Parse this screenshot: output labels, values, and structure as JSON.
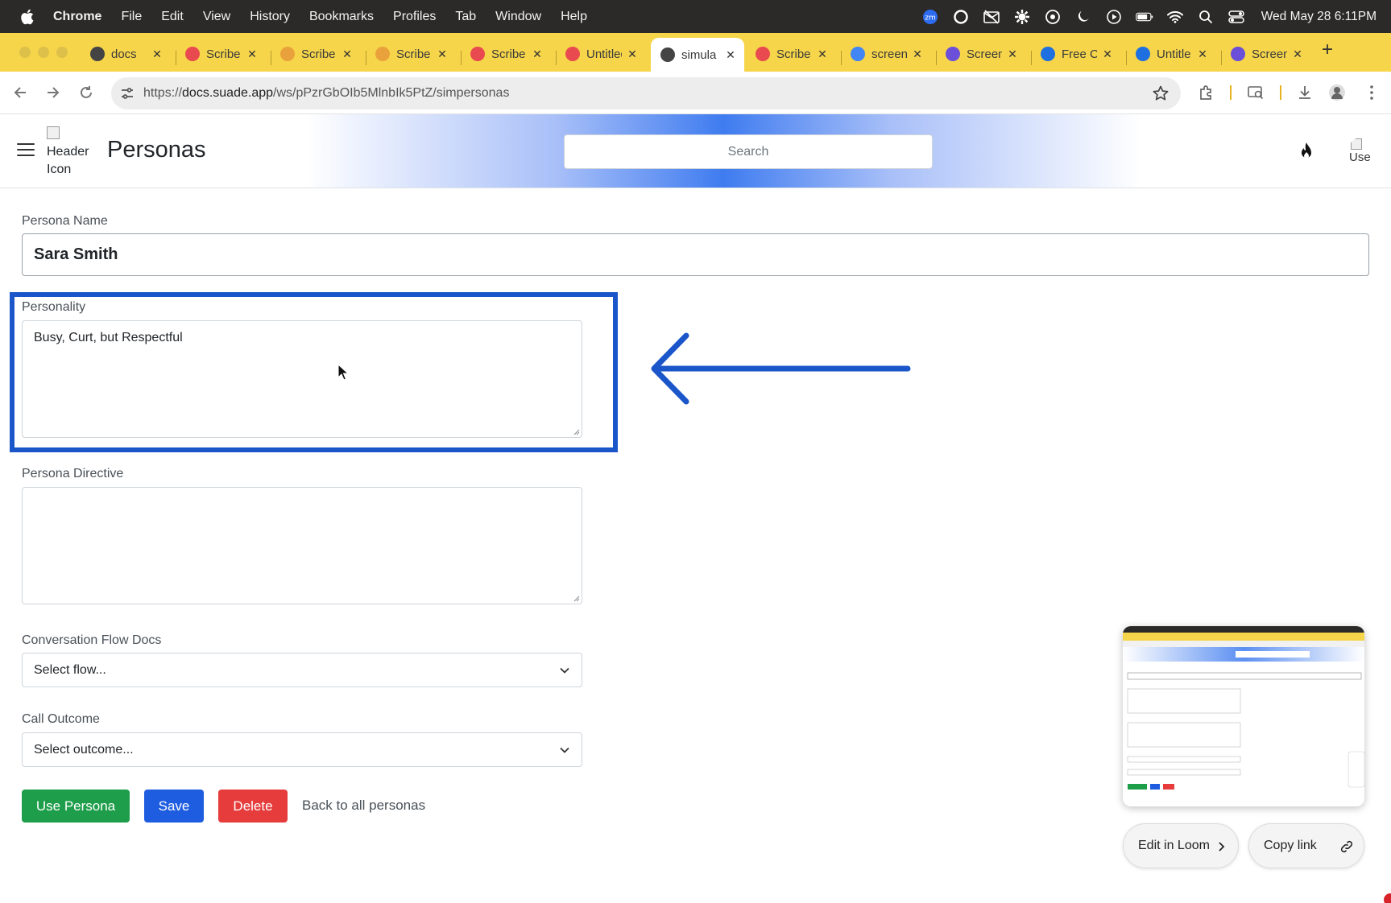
{
  "menubar": {
    "app": "Chrome",
    "items": [
      "File",
      "Edit",
      "View",
      "History",
      "Bookmarks",
      "Profiles",
      "Tab",
      "Window",
      "Help"
    ],
    "clock": "Wed May 28  6:11PM"
  },
  "tabs": [
    {
      "label": "docs",
      "favicon": "suade-icon",
      "color": "#444444"
    },
    {
      "label": "Scribe",
      "favicon": "scribe-icon",
      "color": "#e84a4f"
    },
    {
      "label": "Scribe",
      "favicon": "rainbow-icon",
      "color": "#e9a23b"
    },
    {
      "label": "Scribe",
      "favicon": "rainbow-icon",
      "color": "#e9a23b"
    },
    {
      "label": "Scribe",
      "favicon": "scribe-icon",
      "color": "#e84a4f"
    },
    {
      "label": "Untitled",
      "favicon": "scribe-icon",
      "color": "#e84a4f"
    },
    {
      "label": "simula",
      "favicon": "suade-icon",
      "color": "#444444",
      "active": true
    },
    {
      "label": "Scribe",
      "favicon": "scribe-icon",
      "color": "#e84a4f"
    },
    {
      "label": "screen",
      "favicon": "google-icon",
      "color": "#4285f4"
    },
    {
      "label": "Screen",
      "favicon": "gear-flower-icon",
      "color": "#6b4fd8"
    },
    {
      "label": "Free C",
      "favicon": "c-icon",
      "color": "#1e6fe0"
    },
    {
      "label": "Untitle",
      "favicon": "c-icon",
      "color": "#1e6fe0"
    },
    {
      "label": "Screen",
      "favicon": "gear-flower-icon",
      "color": "#6b4fd8"
    }
  ],
  "address": {
    "prefix": "https://",
    "domain": "docs.suade.app",
    "path": "/ws/pPzrGbOIb5MlnbIk5PtZ/simpersonas"
  },
  "header": {
    "icon_alt": "Header Icon",
    "title": "Personas",
    "search_placeholder": "Search",
    "avatar_alt": "Use"
  },
  "form": {
    "name_label": "Persona Name",
    "name_value": "Sara Smith",
    "personality_label": "Personality",
    "personality_value": "Busy, Curt, but Respectful",
    "directive_label": "Persona Directive",
    "directive_value": "",
    "flow_label": "Conversation Flow Docs",
    "flow_value": "Select flow...",
    "outcome_label": "Call Outcome",
    "outcome_value": "Select outcome...",
    "use_button": "Use Persona",
    "save_button": "Save",
    "delete_button": "Delete",
    "back_link": "Back to all personas"
  },
  "loom": {
    "edit_label": "Edit in Loom",
    "copy_label": "Copy link"
  },
  "colors": {
    "highlight": "#1a56c9",
    "use_button": "#1e9e4a",
    "save_button": "#1f5de0",
    "delete_button": "#e63c3c",
    "tab_strip": "#f6d54a"
  }
}
